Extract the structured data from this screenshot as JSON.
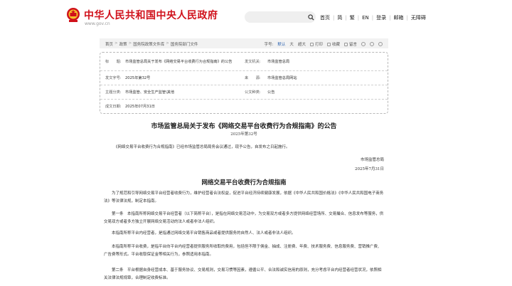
{
  "header": {
    "site_title": "中华人民共和国中央人民政府",
    "site_url": "www.gov.cn",
    "nav": [
      "首页",
      "简",
      "繁",
      "EN",
      "登录",
      "邮箱",
      "无障碍"
    ]
  },
  "breadcrumb": {
    "items": [
      "首页",
      "政策",
      "国务院政策文件库",
      "国务院部门文件"
    ],
    "separator": ">",
    "font_label": "字号:",
    "font_options": [
      "默认",
      "大",
      "超大"
    ],
    "print": "打印",
    "favorite": "收藏",
    "leave": "留言"
  },
  "info_table": {
    "title_label": "标　　题:",
    "title_value": "市场监管总局关于发布《网络交易平台收费行为合规指南》的公告",
    "issuer_label": "发文机关:",
    "issuer_value": "市场监管总局",
    "doc_num_label": "发文字号:",
    "doc_num_value": "2025年第32号",
    "source_label": "来　　源:",
    "source_value": "市场监管总局网站",
    "topic_label": "主题分类:",
    "topic_value": "市场监管、安全生产监管\\其他",
    "type_label": "公文种类:",
    "type_value": "公告",
    "date_label": "成文日期:",
    "date_value": "2025年07月31日"
  },
  "document": {
    "title": "市场监管总局关于发布《网络交易平台收费行为合规指南》的公告",
    "number": "2025年第32号",
    "announce": "《网络交易平台收费行为合规指南》已经市场监管总局局务会议通过，现予公告，自发布之日起施行。",
    "sign_org": "市场监管总局",
    "sign_date": "2025年7月31日",
    "subtitle": "网络交易平台收费行为合规指南",
    "paragraphs": [
      "为了规范和引导网络交易平台经营者收费行为，维护经营者合法权益，促进平台经济持续健康发展，依据《中华人民共和国价格法》《中华人民共和国电子商务法》等法律法规，制定本指南。",
      "第一条　本指南所称网络交易平台经营者（以下简称平台），是指在网络交易活动中，为交易双方或者多方提供网络经营场所、交易撮合、信息发布等服务，供交易双方或者多方独立开展网络交易活动的法人或者非法人组织。",
      "本指南所称平台内经营者，是指通过网络交易平台销售商品或者提供服务的自然人、法人或者非法人组织。",
      "本指南所称平台收费，是指平台向平台内经营者提供服务所收取的费用，包括但不限于佣金、抽成、注册费、年费、技术服务费、信息服务费、营销推广费、广告费等形式。平台收取保证金等相关行为，参照适用本指南。",
      "第二条　平台根据自身经营成本、基于服务协议、交易规则，交易习惯等因素，遵循公平、合法和诚实信用的原则，充分考虑平台内经营者经营状况，依照相关法律法规规章，合理制定收费标准。"
    ]
  }
}
